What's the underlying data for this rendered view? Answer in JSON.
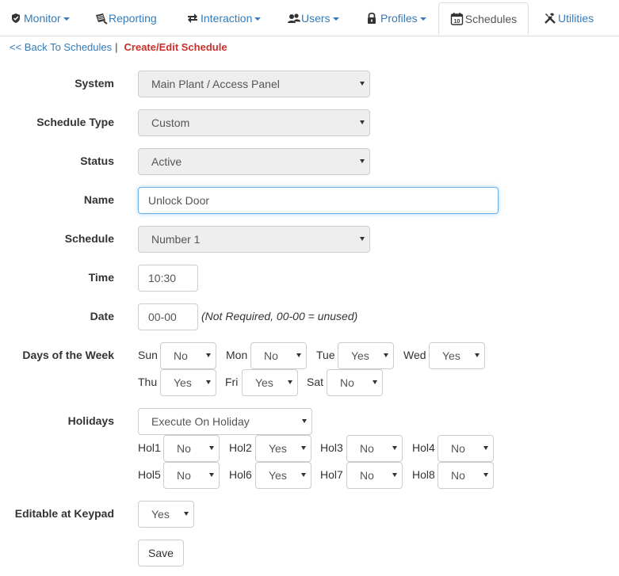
{
  "nav": {
    "monitor": "Monitor",
    "reporting": "Reporting",
    "interaction": "Interaction",
    "users": "Users",
    "profiles": "Profiles",
    "schedules": "Schedules",
    "utilities": "Utilities"
  },
  "breadcrumb": {
    "back": "<< Back To Schedules",
    "separator": "|",
    "current": "Create/Edit Schedule"
  },
  "form": {
    "system_label": "System",
    "system_value": "Main Plant / Access Panel",
    "schedule_type_label": "Schedule Type",
    "schedule_type_value": "Custom",
    "status_label": "Status",
    "status_value": "Active",
    "name_label": "Name",
    "name_value": "Unlock Door",
    "schedule_label": "Schedule",
    "schedule_value": "Number 1",
    "time_label": "Time",
    "time_value": "10:30",
    "date_label": "Date",
    "date_value": "00-00",
    "date_note": "(Not Required, 00-00 = unused)",
    "days_label": "Days of the Week",
    "days": [
      {
        "label": "Sun",
        "value": "No"
      },
      {
        "label": "Mon",
        "value": "No"
      },
      {
        "label": "Tue",
        "value": "Yes"
      },
      {
        "label": "Wed",
        "value": "Yes"
      },
      {
        "label": "Thu",
        "value": "Yes"
      },
      {
        "label": "Fri",
        "value": "Yes"
      },
      {
        "label": "Sat",
        "value": "No"
      }
    ],
    "holidays_label": "Holidays",
    "holidays_mode": "Execute On Holiday",
    "holidays": [
      {
        "label": "Hol1",
        "value": "No"
      },
      {
        "label": "Hol2",
        "value": "Yes"
      },
      {
        "label": "Hol3",
        "value": "No"
      },
      {
        "label": "Hol4",
        "value": "No"
      },
      {
        "label": "Hol5",
        "value": "No"
      },
      {
        "label": "Hol6",
        "value": "Yes"
      },
      {
        "label": "Hol7",
        "value": "No"
      },
      {
        "label": "Hol8",
        "value": "No"
      }
    ],
    "keypad_label": "Editable at Keypad",
    "keypad_value": "Yes",
    "save_label": "Save"
  },
  "colors": {
    "link": "#337ab7",
    "current_crumb": "#c9302c",
    "focus_border": "#66afe9"
  }
}
